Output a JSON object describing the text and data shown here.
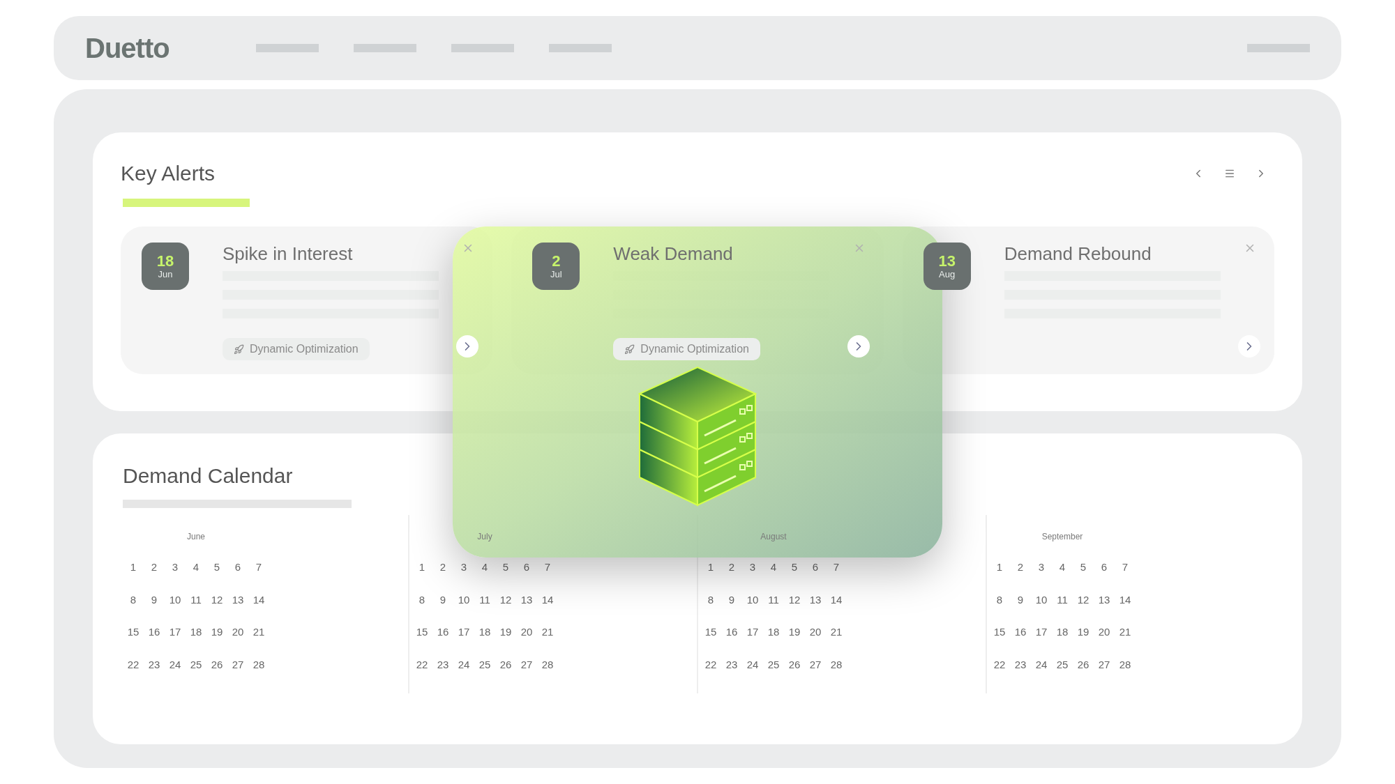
{
  "header": {
    "logo": "Duetto"
  },
  "key_alerts": {
    "title": "Key Alerts",
    "alerts": [
      {
        "day": "18",
        "month": "Jun",
        "title": "Spike in Interest",
        "tag": "Dynamic Optimization"
      },
      {
        "day": "2",
        "month": "Jul",
        "title": "Weak Demand",
        "tag": "Dynamic Optimization"
      },
      {
        "day": "13",
        "month": "Aug",
        "title": "Demand Rebound"
      }
    ]
  },
  "demand_calendar": {
    "title": "Demand Calendar",
    "months": [
      {
        "name": "June",
        "days": [
          "1",
          "2",
          "3",
          "4",
          "5",
          "6",
          "7",
          "8",
          "9",
          "10",
          "11",
          "12",
          "13",
          "14",
          "15",
          "16",
          "17",
          "18",
          "19",
          "20",
          "21",
          "22",
          "23",
          "24",
          "25",
          "26",
          "27",
          "28"
        ]
      },
      {
        "name": "July",
        "days": [
          "1",
          "2",
          "3",
          "4",
          "5",
          "6",
          "7",
          "8",
          "9",
          "10",
          "11",
          "12",
          "13",
          "14",
          "15",
          "16",
          "17",
          "18",
          "19",
          "20",
          "21",
          "22",
          "23",
          "24",
          "25",
          "26",
          "27",
          "28"
        ]
      },
      {
        "name": "August",
        "days": [
          "1",
          "2",
          "3",
          "4",
          "5",
          "6",
          "7",
          "8",
          "9",
          "10",
          "11",
          "12",
          "13",
          "14",
          "15",
          "16",
          "17",
          "18",
          "19",
          "20",
          "21",
          "22",
          "23",
          "24",
          "25",
          "26",
          "27",
          "28"
        ]
      },
      {
        "name": "September",
        "days": [
          "1",
          "2",
          "3",
          "4",
          "5",
          "6",
          "7",
          "8",
          "9",
          "10",
          "11",
          "12",
          "13",
          "14",
          "15",
          "16",
          "17",
          "18",
          "19",
          "20",
          "21",
          "22",
          "23",
          "24",
          "25",
          "26",
          "27",
          "28"
        ]
      }
    ]
  }
}
